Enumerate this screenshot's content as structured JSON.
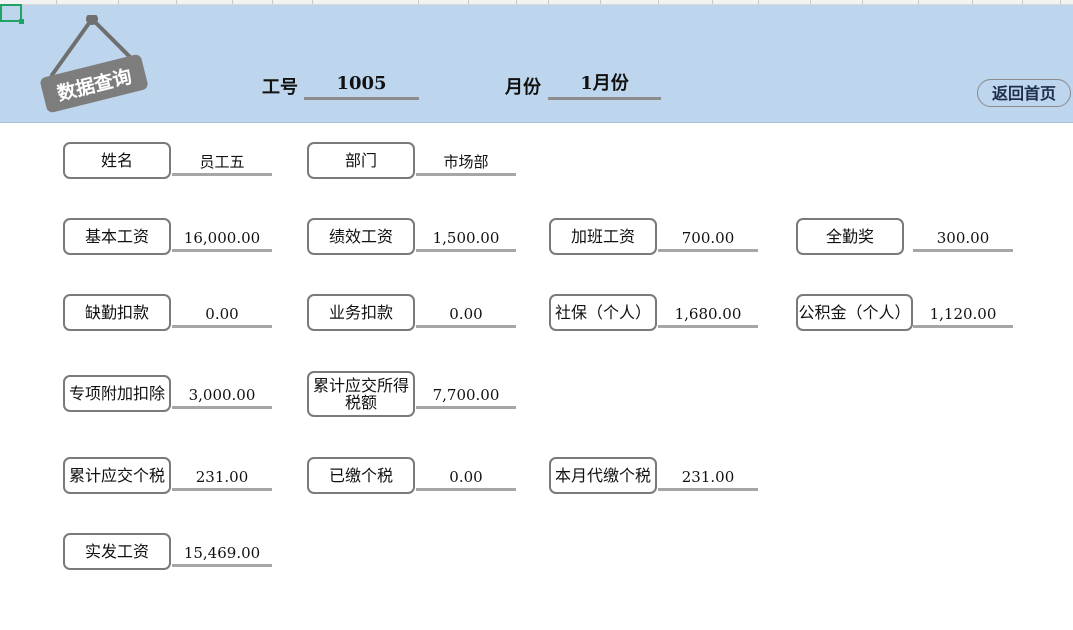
{
  "header": {
    "logo_text": "数据查询",
    "id_label": "工号",
    "id_value": "1005",
    "month_label": "月份",
    "month_value": "1月份",
    "home_button": "返回首页"
  },
  "fields": [
    {
      "label": "姓名",
      "value": "员工五"
    },
    {
      "label": "部门",
      "value": "市场部"
    },
    {
      "label": "基本工资",
      "value": "16,000.00"
    },
    {
      "label": "绩效工资",
      "value": "1,500.00"
    },
    {
      "label": "加班工资",
      "value": "700.00"
    },
    {
      "label": "全勤奖",
      "value": "300.00"
    },
    {
      "label": "缺勤扣款",
      "value": "0.00"
    },
    {
      "label": "业务扣款",
      "value": "0.00"
    },
    {
      "label": "社保（个人）",
      "value": "1,680.00"
    },
    {
      "label": "公积金（个人）",
      "value": "1,120.00"
    },
    {
      "label": "专项附加扣除",
      "value": "3,000.00"
    },
    {
      "label": "累计应交所得税额",
      "value": "7,700.00"
    },
    {
      "label": "累计应交个税",
      "value": "231.00"
    },
    {
      "label": "已缴个税",
      "value": "0.00"
    },
    {
      "label": "本月代缴个税",
      "value": "231.00"
    },
    {
      "label": "实发工资",
      "value": "15,469.00"
    }
  ]
}
